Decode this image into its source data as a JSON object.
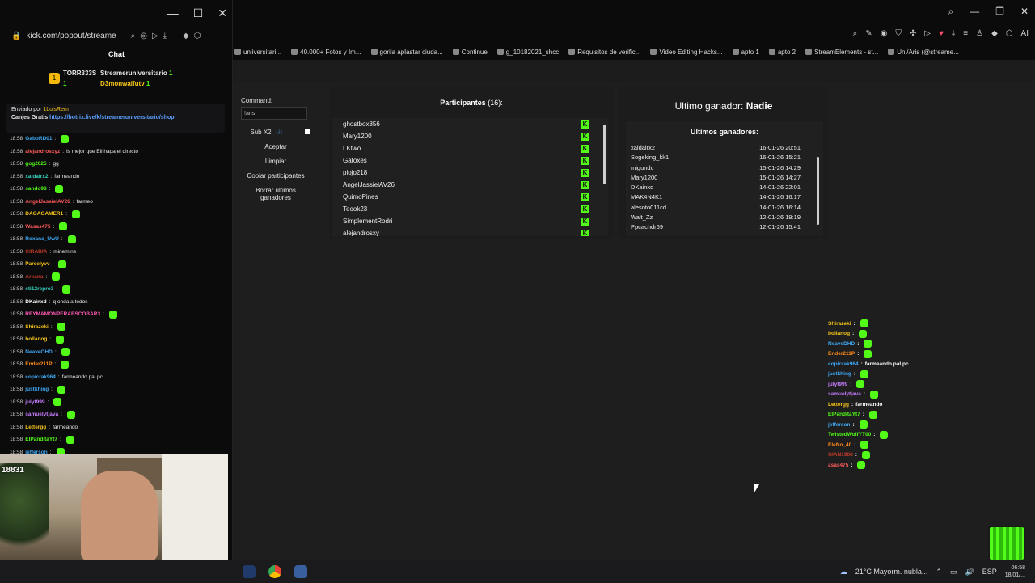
{
  "popout": {
    "url": "kick.com/popout/streame",
    "chat_title": "Chat",
    "leaders": [
      {
        "name": "TORR333S",
        "count": "1"
      },
      {
        "name": "Streameruniversitario",
        "count": "1"
      },
      {
        "name": "D3monwaifutv",
        "count": "1"
      }
    ],
    "leader_rank": "1",
    "pinned": {
      "by_prefix": "Enviado por",
      "by_user": "1LuisRem",
      "label": "Canjes Gratis",
      "link": "https://botrix.live/k/streameruniversitario/shop"
    },
    "chat": [
      {
        "time": "18:58",
        "user": "GaboRD01",
        "msg": "",
        "color": "#3fa9f5"
      },
      {
        "time": "18:58",
        "user": "alejandrosxyz",
        "msg": "ls mejor que Eli haga el directo",
        "color": "#ff5a5a"
      },
      {
        "time": "18:58",
        "user": "gog2025",
        "msg": "gg",
        "color": "#53fc18"
      },
      {
        "time": "18:58",
        "user": "xaldairx2",
        "msg": "farmeando",
        "color": "#36d4c2"
      },
      {
        "time": "18:58",
        "user": "sando98",
        "msg": "",
        "color": "#53fc18"
      },
      {
        "time": "18:58",
        "user": "AngelJassielAV26",
        "msg": "farmeo",
        "color": "#ff5a5a"
      },
      {
        "time": "18:58",
        "user": "DAGAGAMER1",
        "msg": "",
        "color": "#f5c518"
      },
      {
        "time": "18:58",
        "user": "Wasas475",
        "msg": "",
        "color": "#ff5a5a"
      },
      {
        "time": "18:58",
        "user": "Roxana_UwU",
        "msg": "",
        "color": "#3fa9f5"
      },
      {
        "time": "18:58",
        "user": "CIRABIA",
        "msg": "minemine",
        "color": "#c0392b"
      },
      {
        "time": "18:58",
        "user": "Parcelyvv",
        "msg": "",
        "color": "#f5c518"
      },
      {
        "time": "18:58",
        "user": "Arkana",
        "msg": "",
        "color": "#c0392b"
      },
      {
        "time": "18:58",
        "user": "sti12repro3",
        "msg": "",
        "color": "#36d4c2"
      },
      {
        "time": "18:58",
        "user": "DKainxd",
        "msg": "q onda a todos",
        "color": "#ffffff"
      },
      {
        "time": "18:58",
        "user": "REYMAMONPERAESCOBAR3",
        "msg": "",
        "color": "#ff5ab4"
      },
      {
        "time": "18:58",
        "user": "Shirazeki",
        "msg": "",
        "color": "#f5c518"
      },
      {
        "time": "18:58",
        "user": "bollanog",
        "msg": "",
        "color": "#f5c518"
      },
      {
        "time": "18:58",
        "user": "NeaveOHD",
        "msg": "",
        "color": "#3fa9f5"
      },
      {
        "time": "18:58",
        "user": "Ender211P",
        "msg": "",
        "color": "#ff8c1a"
      },
      {
        "time": "18:58",
        "user": "copicrak964",
        "msg": "farmeando pal pc",
        "color": "#3fa9f5"
      },
      {
        "time": "18:58",
        "user": "justkhing",
        "msg": "",
        "color": "#3fa9f5"
      },
      {
        "time": "18:58",
        "user": "julyf999",
        "msg": "",
        "color": "#c77dff"
      },
      {
        "time": "18:58",
        "user": "samuelytjava",
        "msg": "",
        "color": "#c77dff"
      },
      {
        "time": "18:58",
        "user": "Lettergg",
        "msg": "farmeando",
        "color": "#f5c518"
      },
      {
        "time": "18:58",
        "user": "ElPanditaYt7",
        "msg": "",
        "color": "#53fc18"
      },
      {
        "time": "18:58",
        "user": "jefferson",
        "msg": "",
        "color": "#3fa9f5"
      }
    ],
    "cam_label": "18831"
  },
  "browser": {
    "bookmarks": [
      {
        "label": "uniiversitari..."
      },
      {
        "label": "40.000+ Fotos y Im..."
      },
      {
        "label": "gorila aplastar ciuda..."
      },
      {
        "label": "Continue"
      },
      {
        "label": "g_10182021_shcc"
      },
      {
        "label": "Requisitos de verific..."
      },
      {
        "label": "Video Editing Hacks..."
      },
      {
        "label": "apto 1"
      },
      {
        "label": "apto 2"
      },
      {
        "label": "StreamElements - st..."
      },
      {
        "label": "Uni/Aris (@streame..."
      }
    ],
    "ai_label": "AI"
  },
  "giveaway": {
    "command_label": "Command:",
    "command_value": "!aris",
    "sub_label": "Sub X2",
    "buttons": [
      "Aceptar",
      "Limpiar",
      "Copiar participantes",
      "Borrar ultimos ganadores"
    ],
    "participants_title": "Participantes",
    "participants_count": "(16):",
    "participants": [
      "ghostbox856",
      "Mary1200",
      "LKtwo",
      "Gatoxes",
      "piojo218",
      "AngelJassielAV26",
      "QuimoPines",
      "Teook23",
      "SimplementRodri",
      "alejandrosxy"
    ],
    "last_winner_label": "Ultimo ganador:",
    "last_winner": "Nadie",
    "winners_title": "Ultimos ganadores:",
    "winners": [
      {
        "name": "xaldairx2",
        "date": "16-01-26 20:51"
      },
      {
        "name": "Sogeking_kk1",
        "date": "16-01-26 15:21"
      },
      {
        "name": "migundc",
        "date": "15-01-26 14:29"
      },
      {
        "name": "Mary1200",
        "date": "15-01-26 14:27"
      },
      {
        "name": "DKainxd",
        "date": "14-01-26 22:01"
      },
      {
        "name": "MAK4N4K1",
        "date": "14-01-26 16:17"
      },
      {
        "name": "alesoto011cd",
        "date": "14-01-26 16:14"
      },
      {
        "name": "Walt_Zz",
        "date": "12-01-26 19:19"
      },
      {
        "name": "Ppcachdr69",
        "date": "12-01-26 15:41"
      }
    ]
  },
  "overlay_chat": [
    {
      "user": "Shirazeki",
      "msg": "",
      "color": "#f5c518"
    },
    {
      "user": "bollanog",
      "msg": "",
      "color": "#f5c518"
    },
    {
      "user": "NeaveDHD",
      "msg": "",
      "color": "#3fa9f5"
    },
    {
      "user": "Ender211P",
      "msg": "",
      "color": "#ff8c1a"
    },
    {
      "user": "copicrak964",
      "msg": "farmeando pal pc",
      "color": "#3fa9f5"
    },
    {
      "user": "justkhing",
      "msg": "",
      "color": "#3fa9f5"
    },
    {
      "user": "julyf999",
      "msg": "",
      "color": "#c77dff"
    },
    {
      "user": "samuelytjava",
      "msg": "",
      "color": "#c77dff"
    },
    {
      "user": "Lettergg",
      "msg": "farmeando",
      "color": "#f5c518"
    },
    {
      "user": "ElPanditaYt7",
      "msg": "",
      "color": "#53fc18"
    },
    {
      "user": "jefferson",
      "msg": "",
      "color": "#3fa9f5"
    },
    {
      "user": "TwistedWolfYT00",
      "msg": "",
      "color": "#53fc18"
    },
    {
      "user": "Elefro_40",
      "msg": "",
      "color": "#ff8c1a"
    },
    {
      "user": "GIAN1908",
      "msg": "",
      "color": "#c0392b"
    },
    {
      "user": "asas475",
      "msg": "",
      "color": "#ff5a5a"
    }
  ],
  "taskbar": {
    "weather": "21°C  Mayorm. nubla...",
    "lang": "ESP",
    "time": "06:58",
    "date": "18/01/..."
  }
}
